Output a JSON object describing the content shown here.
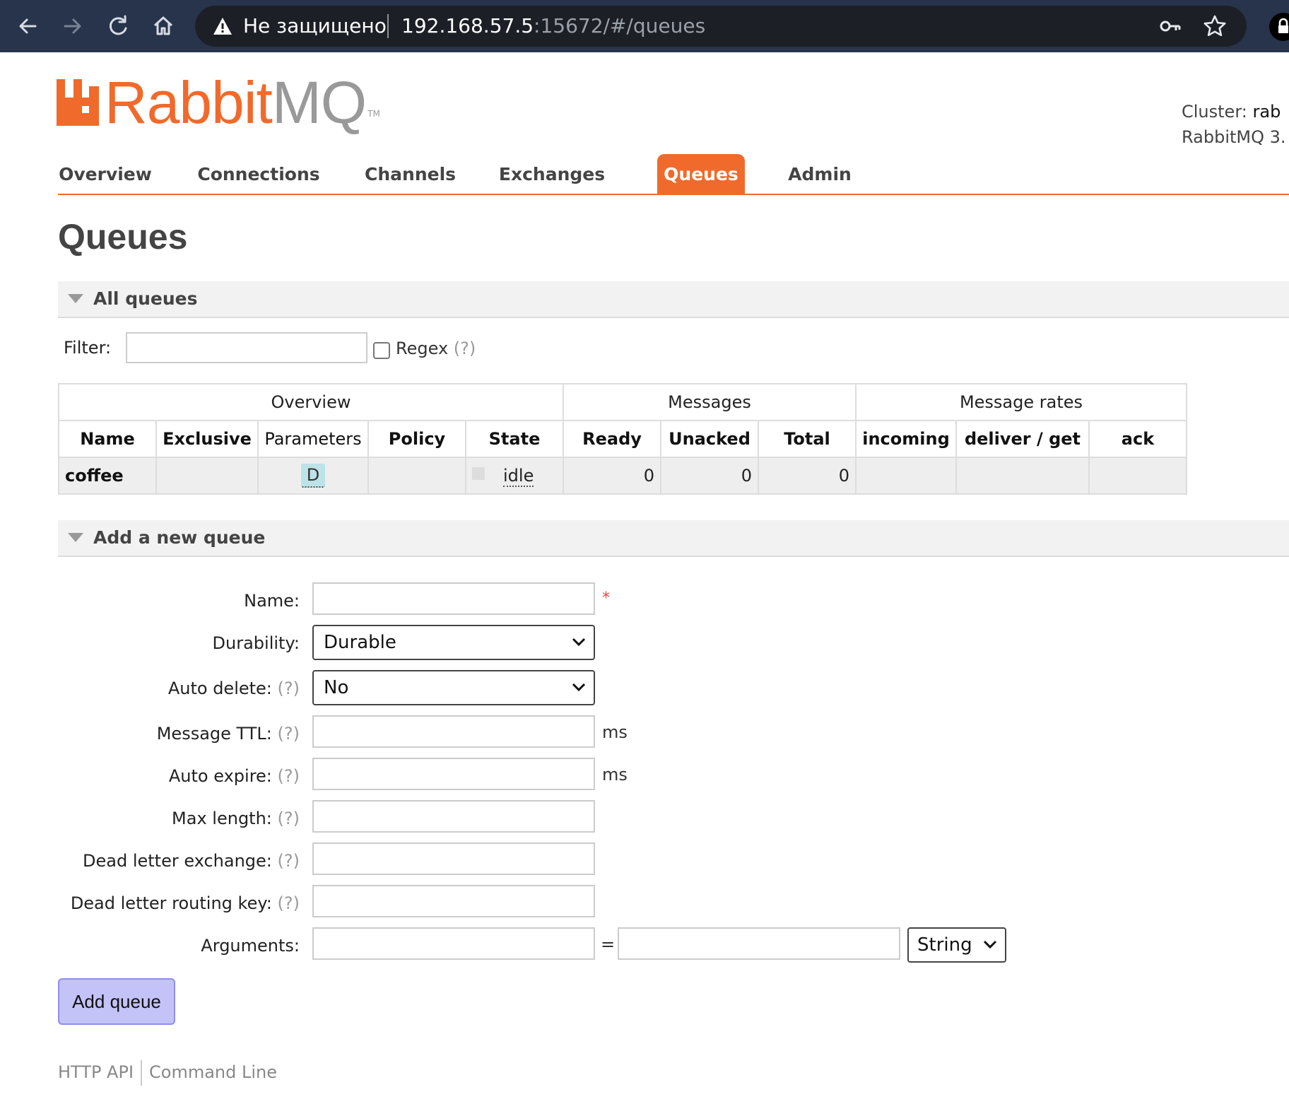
{
  "browser": {
    "security_text": "Не защищено",
    "url_host": "192.168.57.5",
    "url_rest": ":15672/#/queues",
    "icons": [
      "back-icon",
      "forward-icon",
      "reload-icon",
      "home-icon",
      "warning-icon",
      "key-icon",
      "star-icon",
      "lock-icon"
    ]
  },
  "header": {
    "logo_text_rabbit": "Rabbit",
    "logo_text_mq": "MQ",
    "logo_tm": "TM",
    "cluster_label": "Cluster:",
    "cluster_value": "rab",
    "version": "RabbitMQ 3."
  },
  "nav": {
    "tabs": [
      "Overview",
      "Connections",
      "Channels",
      "Exchanges",
      "Queues",
      "Admin"
    ],
    "active": "Queues"
  },
  "page_title": "Queues",
  "all_queues": {
    "heading": "All queues",
    "filter_label": "Filter:",
    "filter_value": "",
    "regex_label": "Regex",
    "regex_help": "(?)",
    "regex_checked": false,
    "table": {
      "groups": [
        "Overview",
        "Messages",
        "Message rates"
      ],
      "columns": [
        "Name",
        "Exclusive",
        "Parameters",
        "Policy",
        "State",
        "Ready",
        "Unacked",
        "Total",
        "incoming",
        "deliver / get",
        "ack"
      ],
      "rows": [
        {
          "name": "coffee",
          "exclusive": "",
          "parameters": "D",
          "policy": "",
          "state": "idle",
          "ready": "0",
          "unacked": "0",
          "total": "0",
          "incoming": "",
          "deliver_get": "",
          "ack": ""
        }
      ]
    }
  },
  "add_queue": {
    "heading": "Add a new queue",
    "help": "(?)",
    "required_mark": "*",
    "fields": {
      "name": {
        "label": "Name:",
        "value": ""
      },
      "durability": {
        "label": "Durability:",
        "value": "Durable"
      },
      "auto_delete": {
        "label": "Auto delete:",
        "value": "No"
      },
      "message_ttl": {
        "label": "Message TTL:",
        "value": "",
        "unit": "ms"
      },
      "auto_expire": {
        "label": "Auto expire:",
        "value": "",
        "unit": "ms"
      },
      "max_length": {
        "label": "Max length:",
        "value": ""
      },
      "dead_letter_exchange": {
        "label": "Dead letter exchange:",
        "value": ""
      },
      "dead_letter_routing_key": {
        "label": "Dead letter routing key:",
        "value": ""
      },
      "arguments": {
        "label": "Arguments:",
        "key": "",
        "eq": "=",
        "value": "",
        "type": "String"
      }
    },
    "submit_label": "Add queue"
  },
  "footer": {
    "links": [
      "HTTP API",
      "Command Line"
    ]
  },
  "colors": {
    "accent": "#f06a2b",
    "chrome": "#27344b",
    "button": "#c3c3f8"
  }
}
